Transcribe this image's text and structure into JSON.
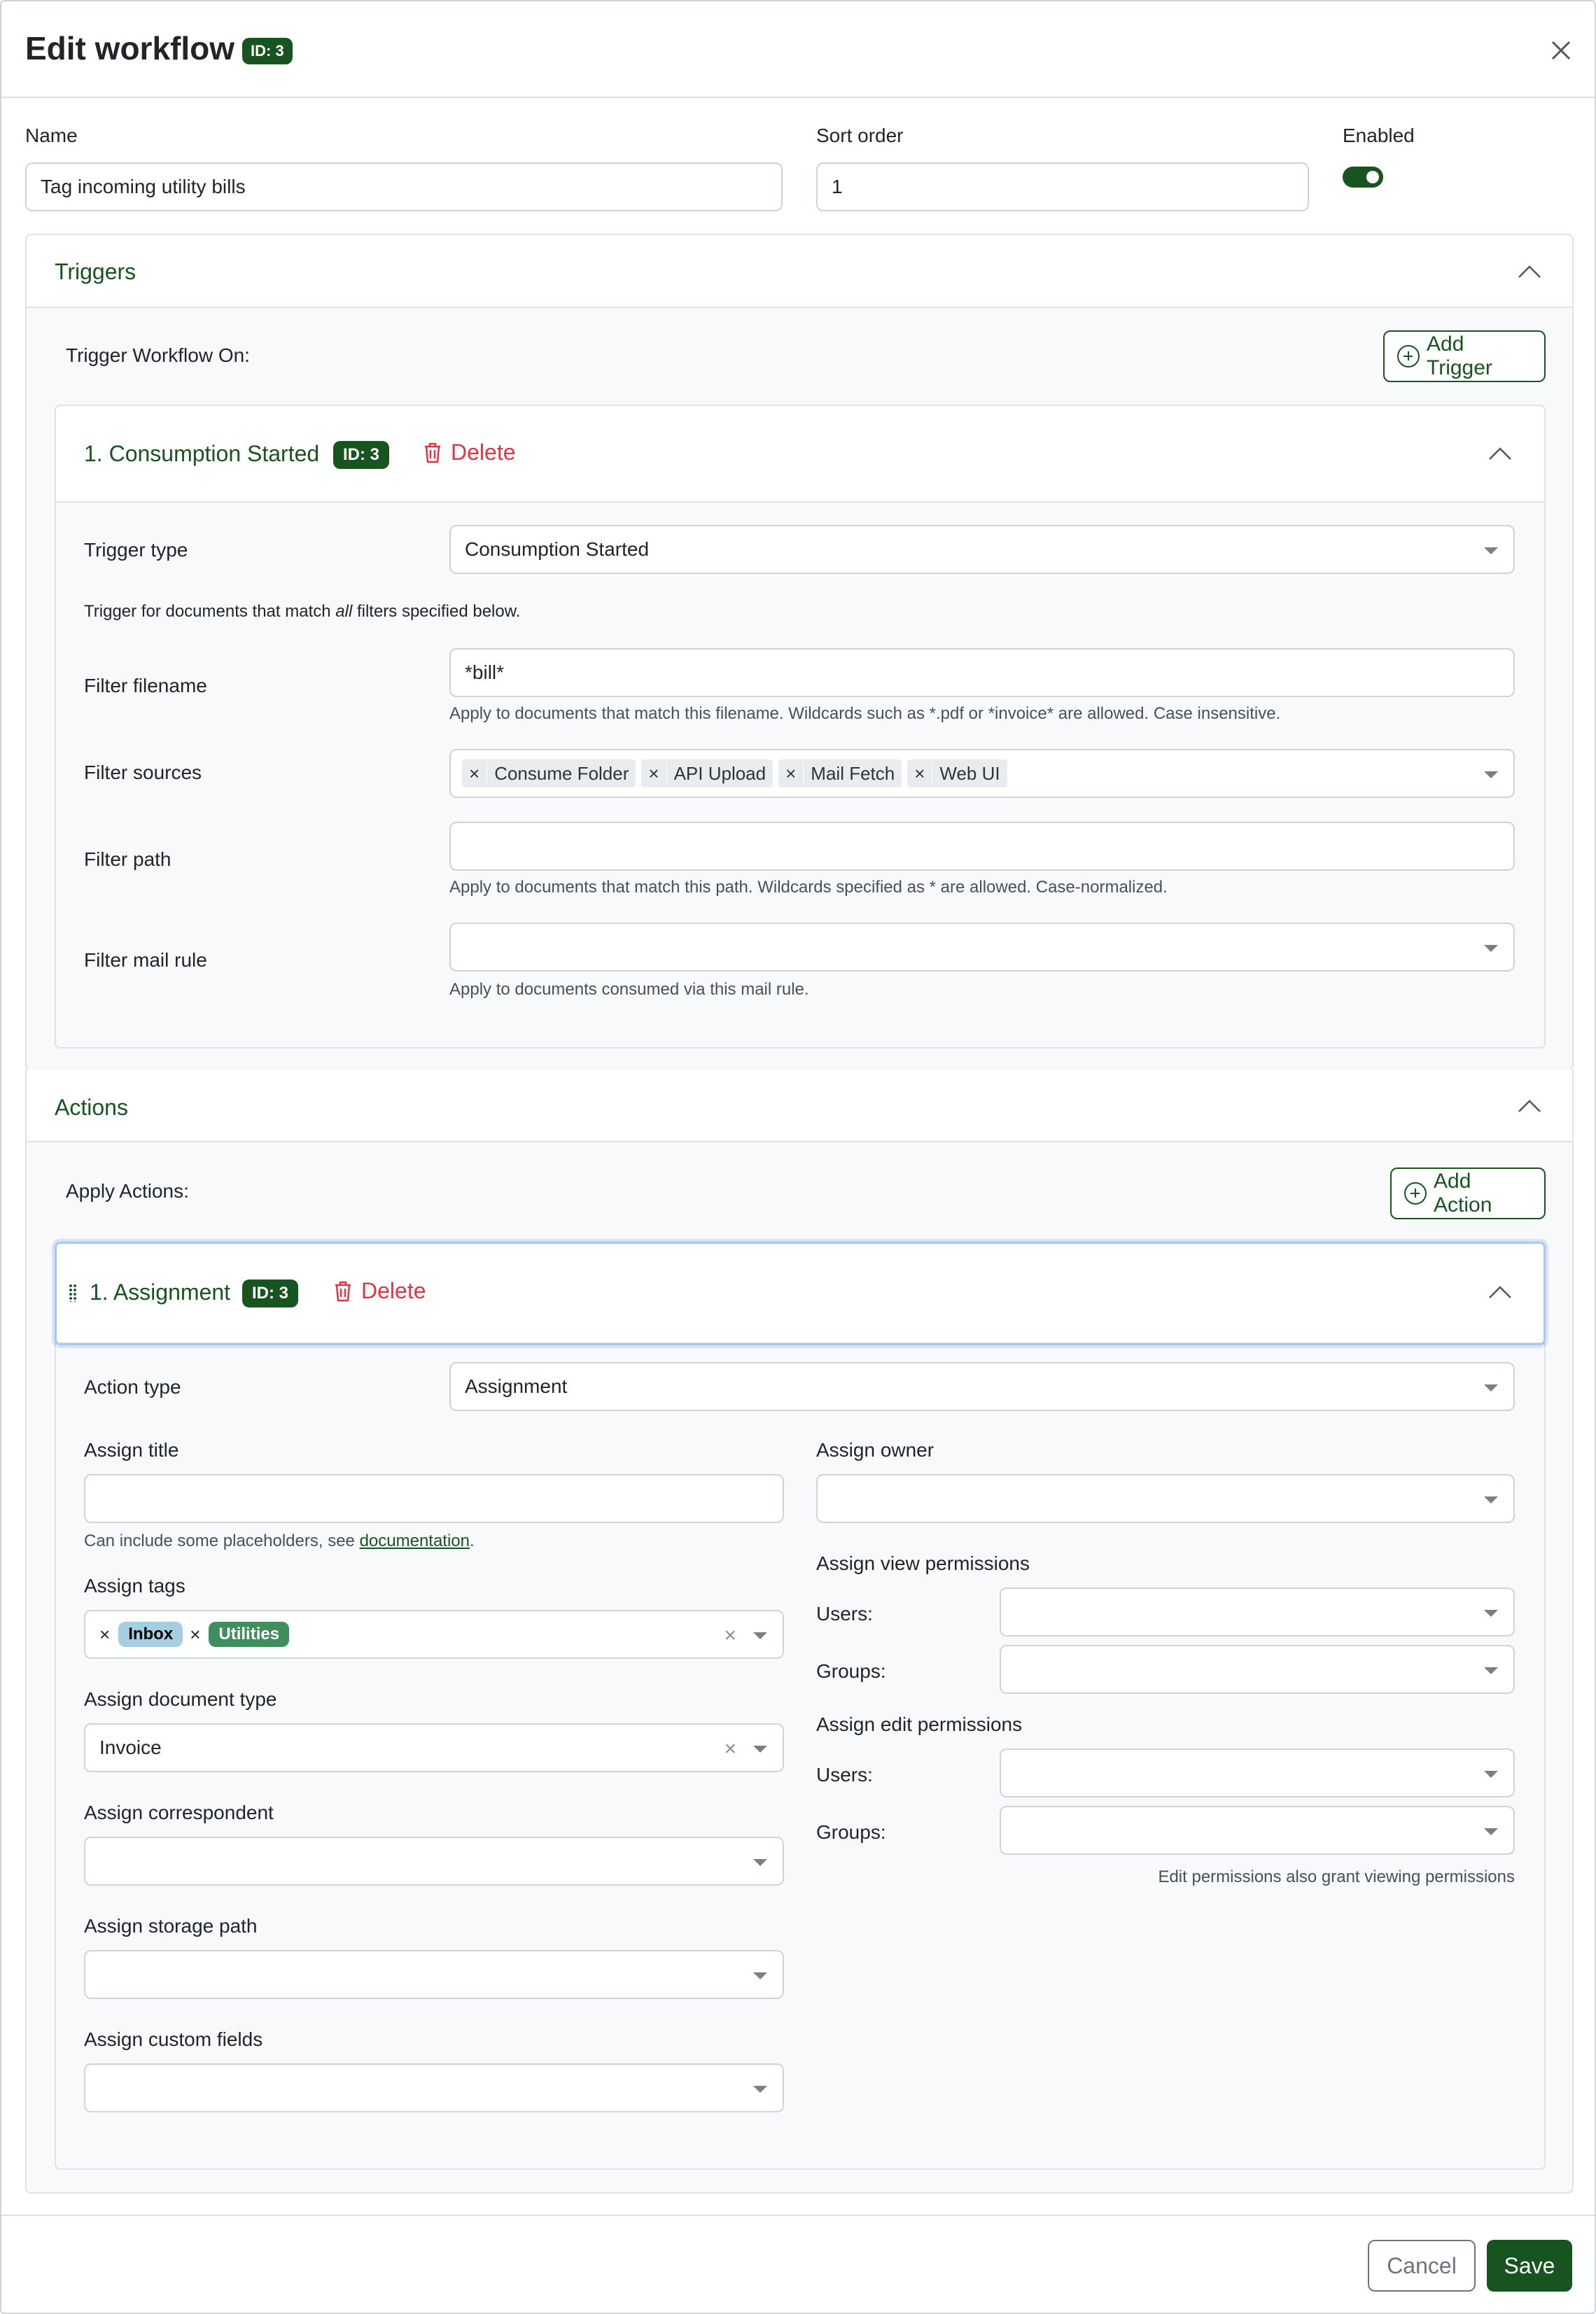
{
  "header": {
    "title": "Edit workflow",
    "id_badge": "ID: 3"
  },
  "general": {
    "name_label": "Name",
    "name_value": "Tag incoming utility bills",
    "sort_label": "Sort order",
    "sort_value": "1",
    "enabled_label": "Enabled",
    "enabled": true
  },
  "triggers": {
    "section_title": "Triggers",
    "intro": "Trigger Workflow On:",
    "add_button": "Add Trigger",
    "item": {
      "title": "1. Consumption Started",
      "id_badge": "ID: 3",
      "delete_label": "Delete",
      "type_label": "Trigger type",
      "type_value": "Consumption Started",
      "match_text_pre": "Trigger for documents that match ",
      "match_text_em": "all",
      "match_text_post": " filters specified below.",
      "filename_label": "Filter filename",
      "filename_value": "*bill*",
      "filename_help": "Apply to documents that match this filename. Wildcards such as *.pdf or *invoice* are allowed. Case insensitive.",
      "sources_label": "Filter sources",
      "sources": [
        "Consume Folder",
        "API Upload",
        "Mail Fetch",
        "Web UI"
      ],
      "path_label": "Filter path",
      "path_help": "Apply to documents that match this path. Wildcards specified as * are allowed. Case-normalized.",
      "mailrule_label": "Filter mail rule",
      "mailrule_help": "Apply to documents consumed via this mail rule."
    }
  },
  "actions": {
    "section_title": "Actions",
    "intro": "Apply Actions:",
    "add_button": "Add Action",
    "item": {
      "title": "1. Assignment",
      "id_badge": "ID: 3",
      "delete_label": "Delete",
      "type_label": "Action type",
      "type_value": "Assignment",
      "title_label": "Assign title",
      "title_help_pre": "Can include some placeholders, see ",
      "title_help_link": "documentation",
      "title_help_post": ".",
      "tags_label": "Assign tags",
      "tags": [
        {
          "name": "Inbox",
          "bg": "#a6cee3",
          "fg": "#000000"
        },
        {
          "name": "Utilities",
          "bg": "#3e8e5e",
          "fg": "#ffffff"
        }
      ],
      "doctype_label": "Assign document type",
      "doctype_value": "Invoice",
      "correspondent_label": "Assign correspondent",
      "storage_label": "Assign storage path",
      "custom_label": "Assign custom fields",
      "owner_label": "Assign owner",
      "view_perm_label": "Assign view permissions",
      "edit_perm_label": "Assign edit permissions",
      "users_label": "Users:",
      "groups_label": "Groups:",
      "edit_note": "Edit permissions also grant viewing permissions"
    }
  },
  "footer": {
    "cancel": "Cancel",
    "save": "Save"
  },
  "colors": {
    "primary": "#17541f",
    "danger": "#dc3545"
  }
}
